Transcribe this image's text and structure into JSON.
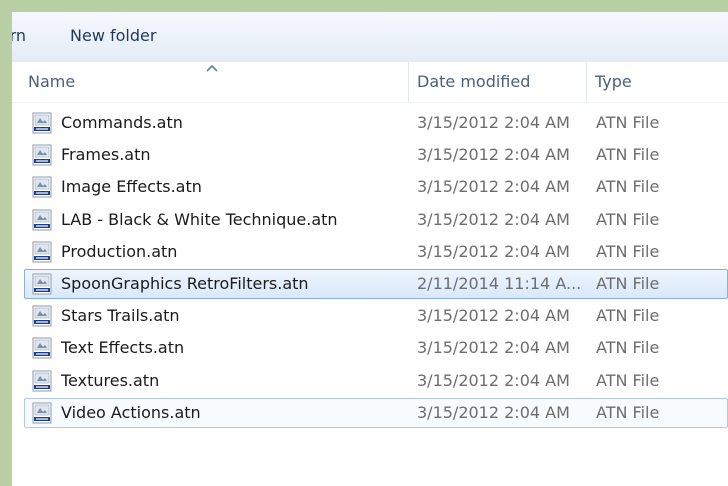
{
  "toolbar": {
    "cut_label": "rn",
    "new_folder_label": "New folder"
  },
  "columns": {
    "name": "Name",
    "date_modified": "Date modified",
    "type": "Type"
  },
  "files": [
    {
      "name": "Commands.atn",
      "date": "3/15/2012 2:04 AM",
      "type": "ATN File"
    },
    {
      "name": "Frames.atn",
      "date": "3/15/2012 2:04 AM",
      "type": "ATN File"
    },
    {
      "name": "Image Effects.atn",
      "date": "3/15/2012 2:04 AM",
      "type": "ATN File"
    },
    {
      "name": "LAB - Black & White Technique.atn",
      "date": "3/15/2012 2:04 AM",
      "type": "ATN File"
    },
    {
      "name": "Production.atn",
      "date": "3/15/2012 2:04 AM",
      "type": "ATN File"
    },
    {
      "name": "SpoonGraphics RetroFilters.atn",
      "date": "2/11/2014 11:14 A...",
      "type": "ATN File"
    },
    {
      "name": "Stars Trails.atn",
      "date": "3/15/2012 2:04 AM",
      "type": "ATN File"
    },
    {
      "name": "Text Effects.atn",
      "date": "3/15/2012 2:04 AM",
      "type": "ATN File"
    },
    {
      "name": "Textures.atn",
      "date": "3/15/2012 2:04 AM",
      "type": "ATN File"
    },
    {
      "name": "Video Actions.atn",
      "date": "3/15/2012 2:04 AM",
      "type": "ATN File"
    }
  ],
  "file_icon": "atn-file-icon",
  "colors": {
    "background": "#b9d0a6",
    "selection_border": "#8cb0dc",
    "header_text": "#4c607a"
  }
}
